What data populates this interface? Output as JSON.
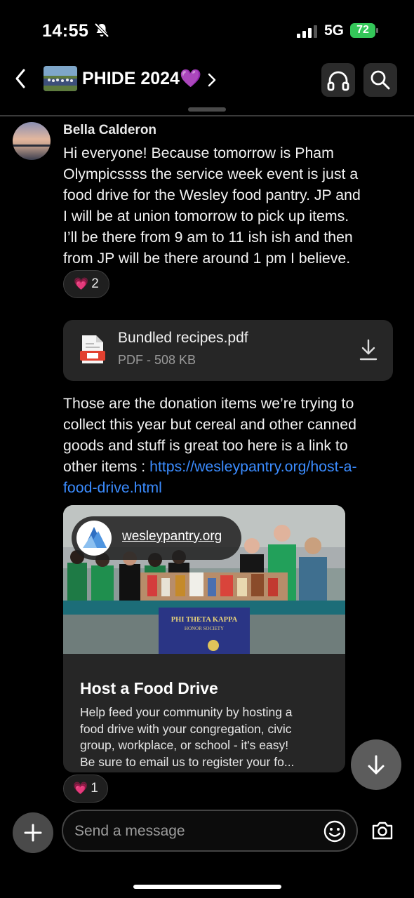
{
  "status_bar": {
    "time": "14:55",
    "network": "5G",
    "battery": "72"
  },
  "header": {
    "title": "PHIDE 2024💜"
  },
  "message": {
    "sender": "Bella Calderon",
    "lines": [
      "Hi everyone! Because tomorrow is Pham",
      "Olympicssss the service week event is just a",
      "food drive for the Wesley food pantry. JP and",
      "I will be at union tomorrow to pick up items.",
      "I’ll be there from 9 am to 11 ish ish  and then",
      "from JP will be there around 1 pm I believe."
    ],
    "reaction_emoji": "💗",
    "reaction_count": "2"
  },
  "file": {
    "name": "Bundled recipes.pdf",
    "meta": "PDF - 508 KB"
  },
  "message2": {
    "lines": [
      "Those are the donation items we’re trying to",
      "collect this year but cereal and other canned",
      "goods and stuff is great too here is a link to"
    ],
    "line4_prefix": "other items : ",
    "link_part1": "https://wesleypantry.org/host-a-",
    "link_part2": "food-drive.html"
  },
  "link_card": {
    "site": "wesleypantry.org",
    "banner_line1": "PHI THETA KAPPA",
    "banner_line2": "HONOR SOCIETY",
    "title": "Host a Food Drive",
    "desc_lines": [
      "Help feed your community by hosting a",
      "food drive with your congregation, civic",
      "group, workplace, or school - it's easy!",
      "Be sure to email us to register your fo..."
    ],
    "reaction_emoji": "💗",
    "reaction_count": "1"
  },
  "composer": {
    "placeholder": "Send a message"
  },
  "colors": {
    "accent_link": "#3b8cff",
    "battery_green": "#34c759",
    "bubble_bg": "#262626"
  }
}
